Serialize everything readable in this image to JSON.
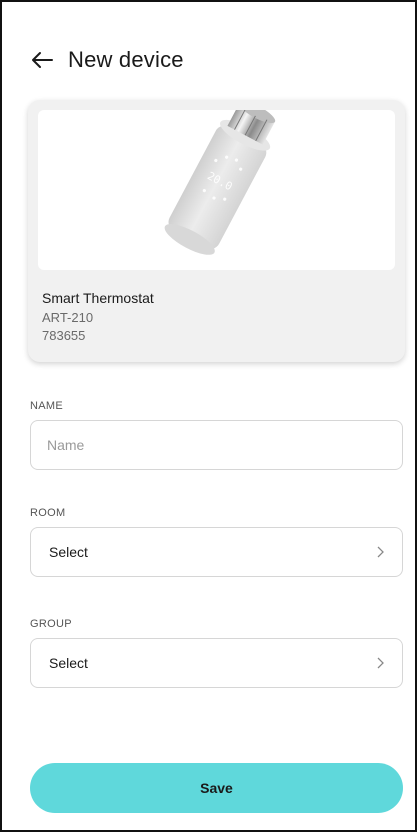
{
  "header": {
    "title": "New device",
    "back_icon": "arrow-left-icon"
  },
  "device": {
    "image_icon": "smart-thermostat-image",
    "name": "Smart Thermostat",
    "model": "ART-210",
    "serial": "783655"
  },
  "form": {
    "name_label": "NAME",
    "name_placeholder": "Name",
    "name_value": "",
    "room_label": "ROOM",
    "room_value": "Select",
    "group_label": "GROUP",
    "group_value": "Select"
  },
  "actions": {
    "save_label": "Save"
  },
  "colors": {
    "accent": "#5fd8db",
    "card_bg": "#f1f1f1",
    "border": "#d6d6d6"
  }
}
